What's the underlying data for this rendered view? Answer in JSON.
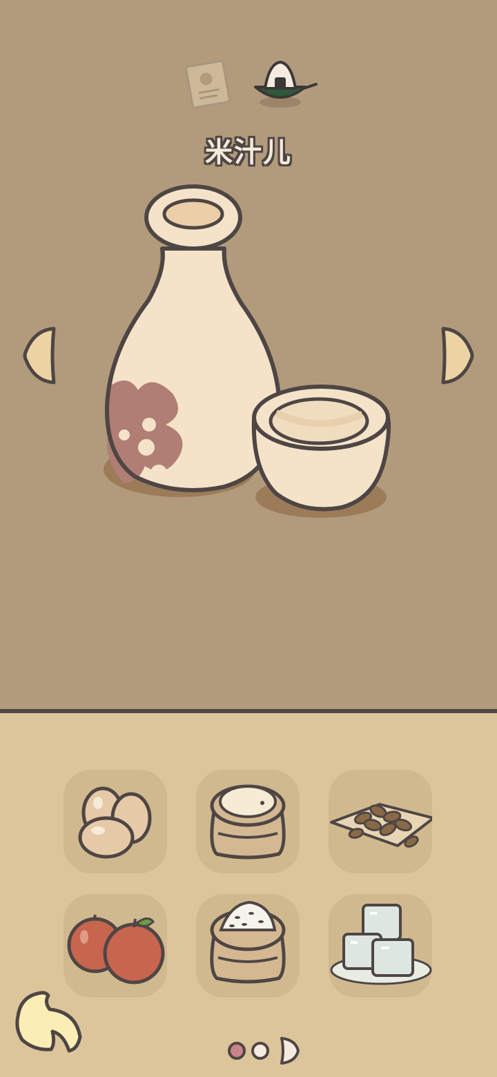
{
  "dish": {
    "name": "米汁儿"
  },
  "header_icons": [
    "recipe-note-icon",
    "rice-ball-plate-icon"
  ],
  "ingredients": [
    {
      "icon": "eggs-icon"
    },
    {
      "icon": "flour-sack-icon"
    },
    {
      "icon": "almonds-icon"
    },
    {
      "icon": "apples-icon"
    },
    {
      "icon": "rice-sack-icon"
    },
    {
      "icon": "ice-cubes-icon"
    }
  ],
  "pagination": {
    "pages": 3,
    "current": 1
  },
  "colors": {
    "top_background": "#b29b7c",
    "bottom_background": "#dcc59a",
    "outline": "#4e4644",
    "cream": "#f3e2c6",
    "flower": "#b07e74"
  }
}
